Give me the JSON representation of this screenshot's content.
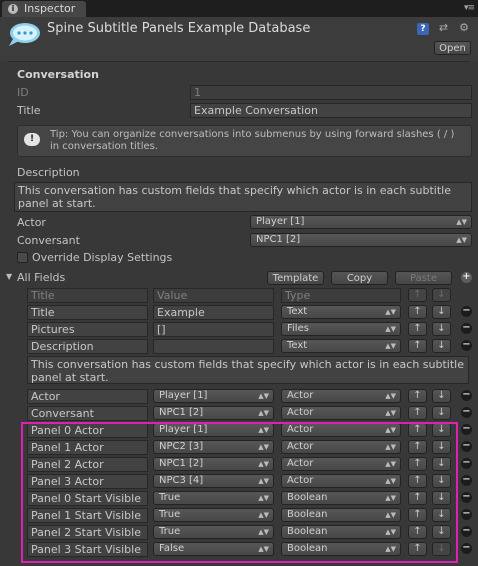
{
  "tab": {
    "label": "Inspector",
    "icon": "info-icon"
  },
  "header": {
    "title": "Spine Subtitle Panels Example Database",
    "open_label": "Open"
  },
  "conversation": {
    "section_title": "Conversation",
    "id_label": "ID",
    "id_value": "1",
    "title_label": "Title",
    "title_value": "Example Conversation",
    "tip": "Tip: You can organize conversations into submenus by using forward slashes ( / ) in conversation titles.",
    "description_label": "Description",
    "description_value": "This conversation has custom fields that specify which actor is in each subtitle panel at start.",
    "actor_label": "Actor",
    "actor_value": "Player [1]",
    "conversant_label": "Conversant",
    "conversant_value": "NPC1 [2]",
    "override_label": "Override Display Settings"
  },
  "all_fields": {
    "label": "All Fields",
    "template_label": "Template",
    "copy_label": "Copy",
    "paste_label": "Paste",
    "col_title": "Title",
    "col_value": "Value",
    "col_type": "Type",
    "up_glyph": "↑",
    "down_glyph": "↓",
    "rows": [
      {
        "title": "Title",
        "value": "Example",
        "value_kind": "text",
        "type": "Text"
      },
      {
        "title": "Pictures",
        "value": "[]",
        "value_kind": "text",
        "type": "Files"
      },
      {
        "title": "Description",
        "value": "",
        "value_kind": "text",
        "type": "Text"
      },
      {
        "title": "Actor",
        "value": "Player [1]",
        "value_kind": "popup",
        "type": "Actor"
      },
      {
        "title": "Conversant",
        "value": "NPC1 [2]",
        "value_kind": "popup",
        "type": "Actor"
      },
      {
        "title": "Panel 0 Actor",
        "value": "Player [1]",
        "value_kind": "popup",
        "type": "Actor"
      },
      {
        "title": "Panel 1 Actor",
        "value": "NPC2 [3]",
        "value_kind": "popup",
        "type": "Actor"
      },
      {
        "title": "Panel 2 Actor",
        "value": "NPC1 [2]",
        "value_kind": "popup",
        "type": "Actor"
      },
      {
        "title": "Panel 3 Actor",
        "value": "NPC3 [4]",
        "value_kind": "popup",
        "type": "Actor"
      },
      {
        "title": "Panel 0 Start Visible",
        "value": "True",
        "value_kind": "popup",
        "type": "Boolean"
      },
      {
        "title": "Panel 1 Start Visible",
        "value": "True",
        "value_kind": "popup",
        "type": "Boolean"
      },
      {
        "title": "Panel 2 Start Visible",
        "value": "True",
        "value_kind": "popup",
        "type": "Boolean"
      },
      {
        "title": "Panel 3 Start Visible",
        "value": "False",
        "value_kind": "popup",
        "type": "Boolean"
      }
    ],
    "description_long": "This conversation has custom fields that specify which actor is in each subtitle panel at start."
  },
  "colors": {
    "highlight": "#e020b0",
    "background": "#383838"
  }
}
